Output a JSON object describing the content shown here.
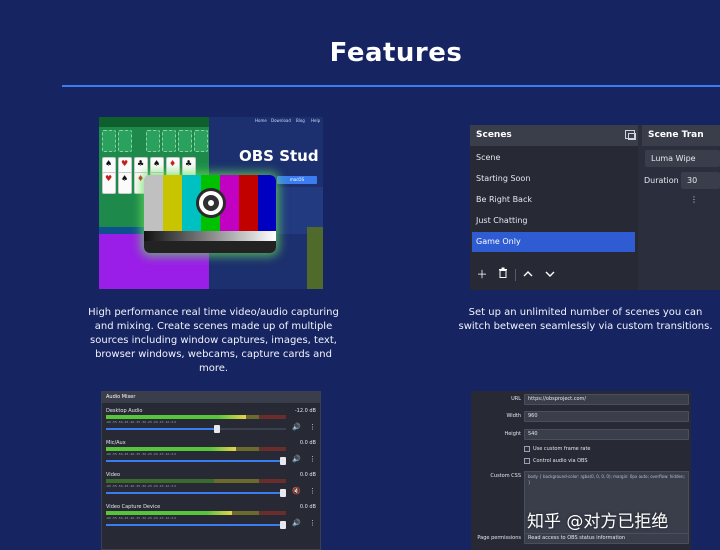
{
  "page": {
    "title": "Features",
    "accent": "#3b7df0",
    "background": "#172462"
  },
  "feature_capture": {
    "description": "High performance real time video/audio capturing and mixing. Create scenes made up of multiple sources including window captures, images, text, browser windows, webcams, capture cards and more.",
    "screenshot": {
      "site_nav": [
        "Home",
        "Download",
        "Blog",
        "Help"
      ],
      "brand": "OBS Stud",
      "download_buttons": [
        "macOS"
      ]
    }
  },
  "feature_scenes": {
    "description": "Set up an unlimited number of scenes you can switch between seamlessly via custom transitions.",
    "panel": {
      "title": "Scenes",
      "items": [
        "Scene",
        "Starting Soon",
        "Be Right Back",
        "Just Chatting",
        "Game Only"
      ],
      "active_item": "Game Only",
      "toolbar": [
        "add-icon",
        "trash-icon",
        "arrow-up-icon",
        "arrow-down-icon"
      ]
    },
    "transitions": {
      "title": "Scene Tran",
      "selected": "Luma Wipe",
      "duration_label": "Duration",
      "duration_value": "30"
    }
  },
  "feature_mixer": {
    "title": "Audio Mixer",
    "tick_labels": "-60  -55  -50  -45  -40  -35  -30  -25  -20  -15  -10   -5    0",
    "channels": [
      {
        "name": "Desktop Audio",
        "db": "-12.0 dB",
        "level": 0.78,
        "volume": 0.62,
        "muted": false
      },
      {
        "name": "Mic/Aux",
        "db": "0.0 dB",
        "level": 0.72,
        "volume": 1.0,
        "muted": false
      },
      {
        "name": "Video",
        "db": "0.0 dB",
        "level": 0.0,
        "volume": 1.0,
        "muted": true
      },
      {
        "name": "Video Capture Device",
        "db": "0.0 dB",
        "level": 0.7,
        "volume": 1.0,
        "muted": false
      }
    ]
  },
  "feature_browser": {
    "url_label": "URL",
    "url_value": "https://obsproject.com/",
    "width_label": "Width",
    "width_value": "960",
    "height_label": "Height",
    "height_value": "540",
    "check_custom_fps": "Use custom frame rate",
    "check_control_audio": "Control audio via OBS",
    "css_label": "Custom CSS",
    "css_value": "body { background-color: rgba(0, 0, 0, 0); margin: 0px auto; overflow: hidden; }",
    "permissions_label": "Page permissions",
    "permissions_value": "Read access to OBS status information"
  },
  "watermark": "知乎 @对方已拒绝"
}
